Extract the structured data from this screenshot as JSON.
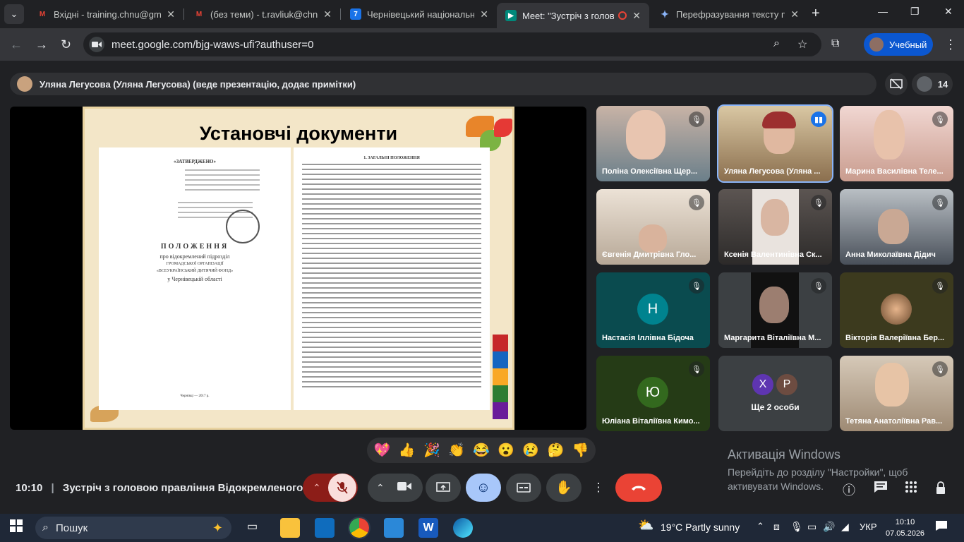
{
  "browser": {
    "tabs": [
      {
        "title": "Вхідні - training.chnu@gmail.",
        "favicon": "gmail-icon",
        "active": false
      },
      {
        "title": "(без теми) - t.ravliuk@chnu.ed",
        "favicon": "gmail-icon",
        "active": false
      },
      {
        "title": "Чернівецький національний",
        "favicon": "site-7-icon",
        "active": false
      },
      {
        "title": "Meet: \"Зустріч з головою",
        "favicon": "meet-icon",
        "active": true
      },
      {
        "title": "Перефразування тексту про",
        "favicon": "gemini-icon",
        "active": false
      }
    ],
    "url": "meet.google.com/bjg-waws-ufi?authuser=0",
    "profile_label": "Учебный"
  },
  "meet": {
    "presenter_banner": "Уляна Легусова (Уляна Легусова) (веде презентацію, додає примітки)",
    "participant_count": "14",
    "slide": {
      "title": "Установчі документи",
      "left_page": {
        "approved": "«ЗАТВЕРДЖЕНО»",
        "heading": "ПОЛОЖЕННЯ",
        "subheading": "про відокремлений підрозділ",
        "org1": "ГРОМАДСЬКОЇ ОРГАНІЗАЦІЇ",
        "org2": "«ВСЕУКРАЇНСЬКИЙ ДИТЯЧИЙ ФОНД»",
        "region": "у Чернівецькій області",
        "footer": "Чернівці — 2017 р."
      },
      "right_page": {
        "section": "1. ЗАГАЛЬНІ ПОЛОЖЕННЯ"
      }
    },
    "participants": [
      {
        "name": "Поліна Олексіївна Щер...",
        "muted": true,
        "type": "video"
      },
      {
        "name": "Уляна Легусова (Уляна ...",
        "muted": false,
        "type": "video",
        "speaking": true
      },
      {
        "name": "Марина Василівна Теле...",
        "muted": true,
        "type": "video"
      },
      {
        "name": "Євгенія Дмитрівна Гло...",
        "muted": true,
        "type": "video"
      },
      {
        "name": "Ксенія Валентинівна Ск...",
        "muted": true,
        "type": "video"
      },
      {
        "name": "Анна Миколаївна Дідич",
        "muted": true,
        "type": "video"
      },
      {
        "name": "Настасія Іллівна Бідоча",
        "muted": true,
        "type": "avatar",
        "initial": "Н",
        "color": "#00838f"
      },
      {
        "name": "Маргарита Віталіївна М...",
        "muted": true,
        "type": "video"
      },
      {
        "name": "Вікторія Валеріївна Бер...",
        "muted": true,
        "type": "photo"
      },
      {
        "name": "Юліана Віталіївна Кимо...",
        "muted": true,
        "type": "avatar",
        "initial": "Ю",
        "color": "#33691e"
      },
      {
        "name": "Ще 2 особи",
        "type": "more",
        "initials": [
          "X",
          "P"
        ]
      },
      {
        "name": "Тетяна Анатоліївна Рав...",
        "muted": true,
        "type": "video"
      }
    ],
    "reactions": [
      "💖",
      "👍",
      "🎉",
      "👏",
      "😂",
      "😮",
      "😢",
      "🤔",
      "👎"
    ],
    "time": "10:10",
    "meeting_title": "Зустріч з головою правління Відокремленого...",
    "activation": {
      "title": "Активація Windows",
      "line1": "Перейдіть до розділу \"Настройки\", щоб",
      "line2": "активувати Windows."
    }
  },
  "taskbar": {
    "search_label": "Пошук",
    "weather": "19°C  Partly sunny",
    "language": "УКР",
    "time": "10:10",
    "date": "07.05.2026"
  },
  "colors": {
    "accent": "#0b57d0",
    "end_call": "#ea4335",
    "muted_button": "#f9dedc",
    "active_button": "#a8c7fa"
  }
}
